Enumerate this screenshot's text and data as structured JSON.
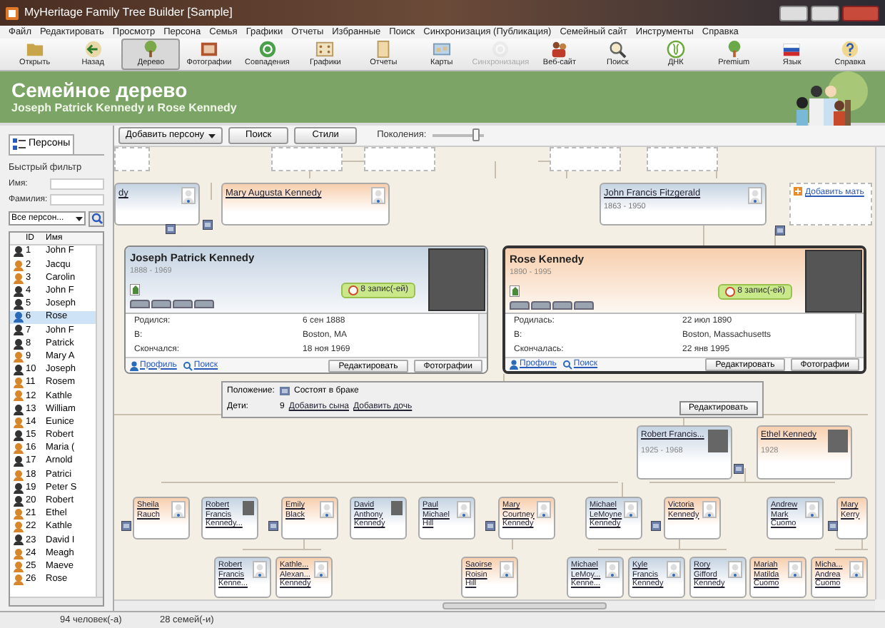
{
  "window": {
    "title": "MyHeritage Family Tree Builder [Sample]"
  },
  "menu": [
    "Файл",
    "Редактировать",
    "Просмотр",
    "Персона",
    "Семья",
    "Графики",
    "Отчеты",
    "Избранные",
    "Поиск",
    "Синхронизация (Публикация)",
    "Семейный сайт",
    "Инструменты",
    "Справка"
  ],
  "toolbar": [
    {
      "label": "Открыть",
      "selected": false,
      "disabled": false
    },
    {
      "label": "Назад",
      "selected": false,
      "disabled": false
    },
    {
      "label": "Дерево",
      "selected": true,
      "disabled": false
    },
    {
      "label": "Фотографии",
      "selected": false,
      "disabled": false
    },
    {
      "label": "Совпадения",
      "selected": false,
      "disabled": false
    },
    {
      "label": "Графики",
      "selected": false,
      "disabled": false
    },
    {
      "label": "Отчеты",
      "selected": false,
      "disabled": false
    },
    {
      "label": "Карты",
      "selected": false,
      "disabled": false
    },
    {
      "label": "Синхронизация",
      "selected": false,
      "disabled": true
    },
    {
      "label": "Веб-сайт",
      "selected": false,
      "disabled": false
    },
    {
      "label": "Поиск",
      "selected": false,
      "disabled": false
    },
    {
      "label": "ДНК",
      "selected": false,
      "disabled": false
    },
    {
      "label": "Premium",
      "selected": false,
      "disabled": false
    },
    {
      "label": "Язык",
      "selected": false,
      "disabled": false
    },
    {
      "label": "Справка",
      "selected": false,
      "disabled": false
    }
  ],
  "banner": {
    "title": "Семейное дерево",
    "subtitle": "Joseph Patrick Kennedy и Rose Kennedy"
  },
  "people_panel": {
    "tab": "Персоны",
    "filter_label": "Быстрый фильтр",
    "first_name_label": "Имя:",
    "last_name_label": "Фамилия:",
    "scope": "Все персон...",
    "columns": [
      "ID",
      "Имя"
    ],
    "rows": [
      {
        "id": "1",
        "name": "John F",
        "kind": "male",
        "selected": false
      },
      {
        "id": "2",
        "name": "Jacqu",
        "kind": "female",
        "selected": false
      },
      {
        "id": "3",
        "name": "Carolin",
        "kind": "female",
        "selected": false
      },
      {
        "id": "4",
        "name": "John F",
        "kind": "male",
        "selected": false
      },
      {
        "id": "5",
        "name": "Joseph",
        "kind": "male",
        "selected": false
      },
      {
        "id": "6",
        "name": "Rose",
        "kind": "female",
        "selected": true
      },
      {
        "id": "7",
        "name": "John F",
        "kind": "male",
        "selected": false
      },
      {
        "id": "8",
        "name": "Patrick",
        "kind": "male",
        "selected": false
      },
      {
        "id": "9",
        "name": "Mary A",
        "kind": "female",
        "selected": false
      },
      {
        "id": "10",
        "name": "Joseph",
        "kind": "male",
        "selected": false
      },
      {
        "id": "11",
        "name": "Rosem",
        "kind": "female",
        "selected": false
      },
      {
        "id": "12",
        "name": "Kathle",
        "kind": "female",
        "selected": false
      },
      {
        "id": "13",
        "name": "William",
        "kind": "male",
        "selected": false
      },
      {
        "id": "14",
        "name": "Eunice",
        "kind": "female",
        "selected": false
      },
      {
        "id": "15",
        "name": "Robert",
        "kind": "male",
        "selected": false
      },
      {
        "id": "16",
        "name": "Maria (",
        "kind": "female",
        "selected": false
      },
      {
        "id": "17",
        "name": "Arnold",
        "kind": "male",
        "selected": false
      },
      {
        "id": "18",
        "name": "Patrici",
        "kind": "female",
        "selected": false
      },
      {
        "id": "19",
        "name": "Peter S",
        "kind": "male",
        "selected": false
      },
      {
        "id": "20",
        "name": "Robert",
        "kind": "male",
        "selected": false
      },
      {
        "id": "21",
        "name": "Ethel",
        "kind": "female",
        "selected": false
      },
      {
        "id": "22",
        "name": "Kathle",
        "kind": "female",
        "selected": false
      },
      {
        "id": "23",
        "name": "David I",
        "kind": "male",
        "selected": false
      },
      {
        "id": "24",
        "name": "Meagh",
        "kind": "female",
        "selected": false
      },
      {
        "id": "25",
        "name": "Maeve",
        "kind": "female",
        "selected": false
      },
      {
        "id": "26",
        "name": "Rose",
        "kind": "female",
        "selected": false
      }
    ]
  },
  "tree_toolbar": {
    "add_button": "Добавить персону",
    "search_button": "Поиск",
    "styles_button": "Стили",
    "generations": {
      "label": "Поколения:",
      "level": 0.9
    }
  },
  "tree": {
    "ancestors": [
      {
        "name": "dy",
        "kind": "male"
      },
      {
        "name": "Mary Augusta Kennedy",
        "kind": "female"
      },
      {
        "name": "John Francis Fitzgerald",
        "dates": "1863 - 1950",
        "kind": "male"
      }
    ],
    "add_mother": "Добавить мать",
    "main_couple": [
      {
        "name": "Joseph Patrick Kennedy",
        "dates": "1888 - 1969",
        "kind": "male",
        "selected": false,
        "records": "8 запис(-ей)",
        "fields": [
          {
            "label": "Родился:",
            "value": "6 сен 1888"
          },
          {
            "label": "В:",
            "value": "Boston, MA"
          },
          {
            "label": "Скончался:",
            "value": "18 ноя 1969"
          }
        ],
        "profile": "Профиль",
        "search": "Поиск",
        "edit": "Редактировать",
        "photos": "Фотографии"
      },
      {
        "name": "Rose Kennedy",
        "dates": "1890 - 1995",
        "kind": "female",
        "selected": true,
        "records": "8 запис(-ей)",
        "fields": [
          {
            "label": "Родилась:",
            "value": "22 июл 1890"
          },
          {
            "label": "В:",
            "value": "Boston, Massachusetts"
          },
          {
            "label": "Скончалась:",
            "value": "22 янв 1995"
          }
        ],
        "profile": "Профиль",
        "search": "Поиск",
        "edit": "Редактировать",
        "photos": "Фотографии"
      }
    ],
    "family": {
      "status_label": "Положение:",
      "status": "Состоят в браке",
      "children_label": "Дети:",
      "children_count": "9",
      "add_son": "Добавить сына",
      "add_daughter": "Добавить дочь",
      "edit": "Редактировать"
    },
    "child_couple": [
      {
        "name": "Robert Francis...",
        "dates": "1925 - 1968",
        "kind": "male",
        "photo": true
      },
      {
        "name": "Ethel Kennedy",
        "dates": "1928",
        "kind": "female",
        "photo": true
      }
    ],
    "grandchildren": [
      {
        "name": "Sheila Rauch",
        "kind": "female",
        "photo": false
      },
      {
        "name": "Robert Francis Kennedy...",
        "kind": "male",
        "photo": true
      },
      {
        "name": "Emily Black",
        "kind": "female",
        "photo": false
      },
      {
        "name": "David Anthony Kennedy",
        "kind": "male",
        "photo": true
      },
      {
        "name": "Paul Michael Hill",
        "kind": "male",
        "photo": false
      },
      {
        "name": "Mary Courtney Kennedy",
        "kind": "female",
        "photo": false
      },
      {
        "name": "Michael LeMoyne Kennedy",
        "kind": "male",
        "photo": false
      },
      {
        "name": "Victoria Kennedy",
        "kind": "female",
        "photo": false
      },
      {
        "name": "Andrew Mark Cuomo",
        "kind": "male",
        "photo": false
      },
      {
        "name": "Mary Kerry",
        "kind": "female"
      }
    ],
    "great_grandchildren": [
      {
        "name": "Robert Francis Kenne...",
        "kind": "male",
        "photo": false
      },
      {
        "name": "Kathle... Alexan... Kennedy",
        "kind": "female",
        "photo": false
      },
      {
        "name": "Saoirse Roisin Hill",
        "kind": "female",
        "photo": false
      },
      {
        "name": "Michael LeMoy... Kenne...",
        "kind": "male",
        "photo": false
      },
      {
        "name": "Kyle Francis Kennedy",
        "kind": "male",
        "photo": false
      },
      {
        "name": "Rory Gifford Kennedy",
        "kind": "male",
        "photo": false
      },
      {
        "name": "Mariah Matilda Cuomo",
        "kind": "female",
        "photo": false
      },
      {
        "name": "Micha... Andrea Cuomo",
        "kind": "female",
        "photo": false
      }
    ]
  },
  "status_bar": [
    "94 человек(-а)",
    "28 семей(-и)"
  ]
}
